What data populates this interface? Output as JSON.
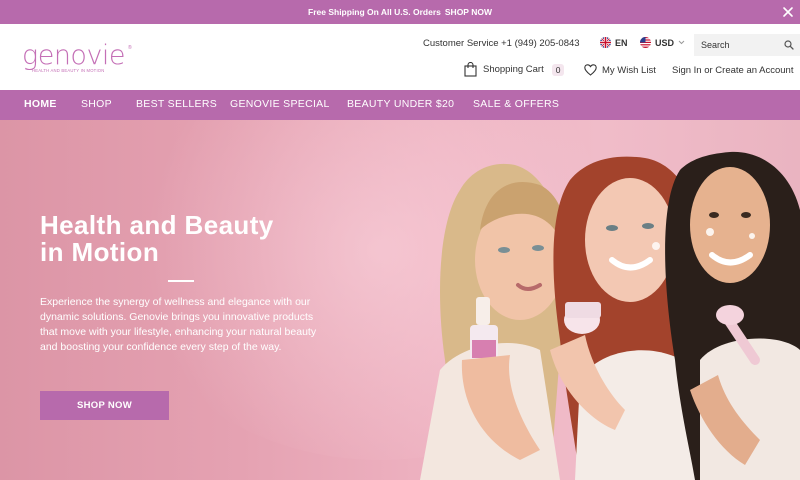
{
  "announcement": {
    "text": "Free Shipping On All U.S. Orders",
    "link": "SHOP NOW"
  },
  "brand": {
    "name": "genovie",
    "tagline": "HEALTH AND BEAUTY IN MOTION",
    "reg_mark": "®",
    "color": "#c46fb6"
  },
  "header": {
    "customer_service": "Customer Service +1 (949) 205-0843",
    "language": "EN",
    "currency": "USD",
    "search_placeholder": "Search",
    "cart_label": "Shopping Cart",
    "cart_count": "0",
    "wishlist_label": "My Wish List",
    "account_label": "Sign In or Create an Account"
  },
  "nav": {
    "items": [
      "HOME",
      "SHOP",
      "BEST SELLERS",
      "GENOVIE SPECIAL",
      "BEAUTY UNDER $20",
      "SALE & OFFERS"
    ]
  },
  "hero": {
    "title_line1": "Health and Beauty",
    "title_line2": "in Motion",
    "body": "Experience the synergy of wellness and elegance with our dynamic solutions. Genovie brings you innovative products that move with your lifestyle, enhancing your natural beauty and boosting your confidence every step of the way.",
    "cta": "SHOP NOW"
  },
  "icons": [
    "close-icon",
    "uk-flag-icon",
    "us-flag-icon",
    "chevron-down-icon",
    "search-icon",
    "cart-icon",
    "heart-icon"
  ],
  "colors": {
    "accent": "#b76aac",
    "hero_bg": "#e5a2b2"
  }
}
